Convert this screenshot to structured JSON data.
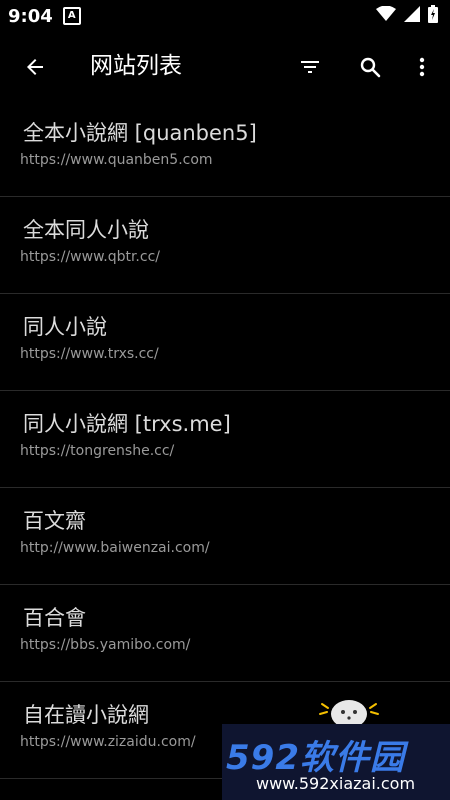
{
  "status_bar": {
    "time": "9:04",
    "notification_icon": "A",
    "icons": [
      "wifi-icon",
      "signal-icon",
      "battery-icon"
    ]
  },
  "toolbar": {
    "title": "网站列表",
    "icons": [
      "back-arrow-icon",
      "filter-icon",
      "search-icon",
      "more-vert-icon"
    ]
  },
  "sites": [
    {
      "name": "全本小說網 [quanben5]",
      "url": "https://www.quanben5.com"
    },
    {
      "name": "全本同人小說",
      "url": "https://www.qbtr.cc/"
    },
    {
      "name": "同人小說",
      "url": "https://www.trxs.cc/"
    },
    {
      "name": "同人小說網 [trxs.me]",
      "url": "https://tongrenshe.cc/"
    },
    {
      "name": "百文齋",
      "url": "http://www.baiwenzai.com/"
    },
    {
      "name": "百合會",
      "url": "https://bbs.yamibo.com/"
    },
    {
      "name": "自在讀小說網",
      "url": "https://www.zizaidu.com/"
    }
  ],
  "watermark": {
    "logo": "592软件园",
    "site": "www.592xiazai.com"
  },
  "colors": {
    "background": "#000000",
    "primary_text": "#dcdcdc",
    "secondary_text": "#9a9a9a",
    "divider": "#2a2a2a",
    "watermark_blue": "#3a7be8"
  }
}
